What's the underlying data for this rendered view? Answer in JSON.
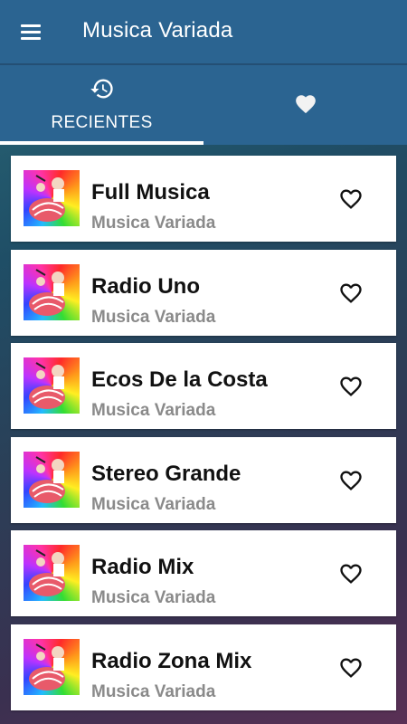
{
  "app_bar": {
    "title": "Musica Variada",
    "menu_icon": "hamburger-menu-icon"
  },
  "tabs": [
    {
      "label": "RECIENTES",
      "icon": "history-icon",
      "selected": true
    },
    {
      "label": "",
      "icon": "heart-filled-icon",
      "selected": false
    }
  ],
  "stations": [
    {
      "title": "Full Musica",
      "subtitle": "Musica Variada",
      "favorite_icon": "heart-outline-icon"
    },
    {
      "title": "Radio Uno",
      "subtitle": "Musica Variada",
      "favorite_icon": "heart-outline-icon"
    },
    {
      "title": "Ecos De la Costa",
      "subtitle": "Musica Variada",
      "favorite_icon": "heart-outline-icon"
    },
    {
      "title": "Stereo Grande",
      "subtitle": "Musica Variada",
      "favorite_icon": "heart-outline-icon"
    },
    {
      "title": "Radio Mix",
      "subtitle": "Musica Variada",
      "favorite_icon": "heart-outline-icon"
    },
    {
      "title": "Radio Zona Mix",
      "subtitle": "Musica Variada",
      "favorite_icon": "heart-outline-icon"
    }
  ],
  "colors": {
    "app_bar": "#2b6491",
    "title_text": "#111111",
    "subtitle_text": "#8a8a8a"
  }
}
